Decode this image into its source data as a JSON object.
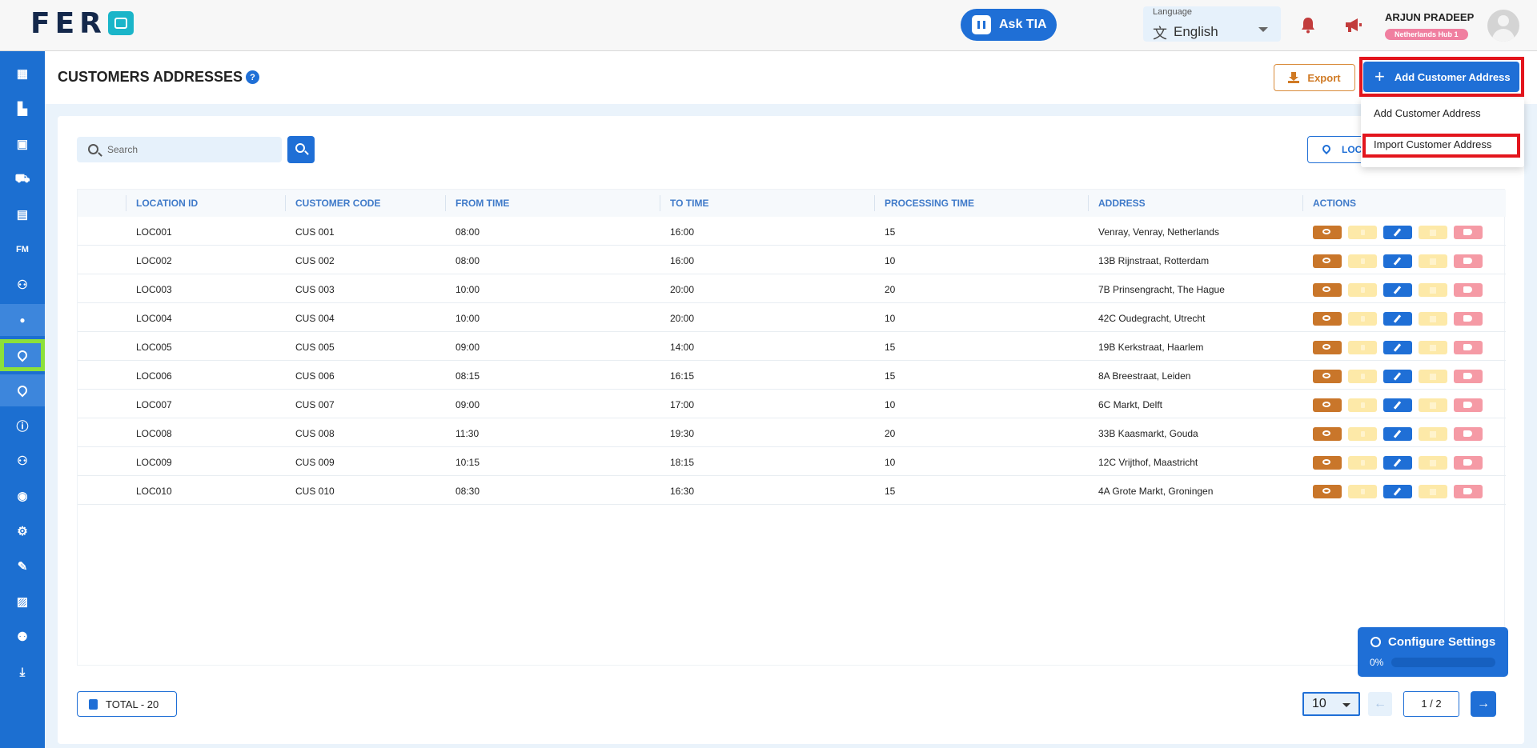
{
  "app": {
    "logo_text": "FER",
    "ask_tia": "Ask TIA",
    "language_label": "Language",
    "language_value": "English",
    "user_name": "ARJUN PRADEEP",
    "user_hub": "Netherlands Hub 1"
  },
  "sidebar": {
    "items": [
      {
        "icon": "dashboard-icon",
        "glyph": "▦"
      },
      {
        "icon": "analytics-icon",
        "glyph": "▙"
      },
      {
        "icon": "calendar-edit-icon",
        "glyph": "▣"
      },
      {
        "icon": "truck-icon",
        "glyph": "⛟"
      },
      {
        "icon": "archive-icon",
        "glyph": "▤"
      },
      {
        "icon": "fm-icon",
        "glyph": "FM"
      },
      {
        "icon": "customers-icon",
        "glyph": "⚇"
      },
      {
        "icon": "person-icon",
        "glyph": "●"
      },
      {
        "icon": "location-pin-icon",
        "glyph": ""
      },
      {
        "icon": "location-check-icon",
        "glyph": ""
      },
      {
        "icon": "info-icon",
        "glyph": "ⓘ"
      },
      {
        "icon": "team-icon",
        "glyph": "⚇"
      },
      {
        "icon": "support-icon",
        "glyph": "◉"
      },
      {
        "icon": "settings-gear-icon",
        "glyph": "⚙"
      },
      {
        "icon": "notes-edit-icon",
        "glyph": "✎"
      },
      {
        "icon": "documents-icon",
        "glyph": "▨"
      },
      {
        "icon": "user-management-icon",
        "glyph": "⚉"
      },
      {
        "icon": "download-icon",
        "glyph": "⤓"
      }
    ]
  },
  "header": {
    "title": "CUSTOMERS ADDRESSES",
    "help": "?",
    "export_label": "Export",
    "add_label": "Add Customer Address"
  },
  "dropdown": {
    "items": [
      "Add Customer Address",
      "Import Customer Address"
    ]
  },
  "toolbar": {
    "search_placeholder": "Search",
    "location_button": "LOCATIONS"
  },
  "table": {
    "columns": [
      "LOCATION ID",
      "CUSTOMER CODE",
      "FROM TIME",
      "TO TIME",
      "PROCESSING TIME",
      "ADDRESS",
      "ACTIONS"
    ],
    "rows": [
      [
        "LOC001",
        "CUS 001",
        "08:00",
        "16:00",
        "15",
        "Venray, Venray, Netherlands"
      ],
      [
        "LOC002",
        "CUS 002",
        "08:00",
        "16:00",
        "10",
        "13B Rijnstraat, Rotterdam"
      ],
      [
        "LOC003",
        "CUS 003",
        "10:00",
        "20:00",
        "20",
        "7B Prinsengracht, The Hague"
      ],
      [
        "LOC004",
        "CUS 004",
        "10:00",
        "20:00",
        "10",
        "42C Oudegracht, Utrecht"
      ],
      [
        "LOC005",
        "CUS 005",
        "09:00",
        "14:00",
        "15",
        "19B Kerkstraat, Haarlem"
      ],
      [
        "LOC006",
        "CUS 006",
        "08:15",
        "16:15",
        "15",
        "8A Breestraat, Leiden"
      ],
      [
        "LOC007",
        "CUS 007",
        "09:00",
        "17:00",
        "10",
        "6C Markt, Delft"
      ],
      [
        "LOC008",
        "CUS 008",
        "11:30",
        "19:30",
        "20",
        "33B Kaasmarkt, Gouda"
      ],
      [
        "LOC009",
        "CUS 009",
        "10:15",
        "18:15",
        "10",
        "12C Vrijthof, Maastricht"
      ],
      [
        "LOC010",
        "CUS 010",
        "08:30",
        "16:30",
        "15",
        "4A Grote Markt, Groningen"
      ]
    ]
  },
  "footer": {
    "total_label": "TOTAL  - 20",
    "per_page": "10",
    "prev": "←",
    "page_indicator": "1  /  2",
    "next": "→"
  },
  "config": {
    "title": "Configure Settings",
    "percent_label": "0%",
    "progress": 0
  },
  "colors": {
    "primary": "#1f6fd6",
    "sidebar": "#1c6fd1",
    "highlight_red": "#e3151d",
    "highlight_green": "#8ce03a",
    "export": "#d07a24"
  }
}
